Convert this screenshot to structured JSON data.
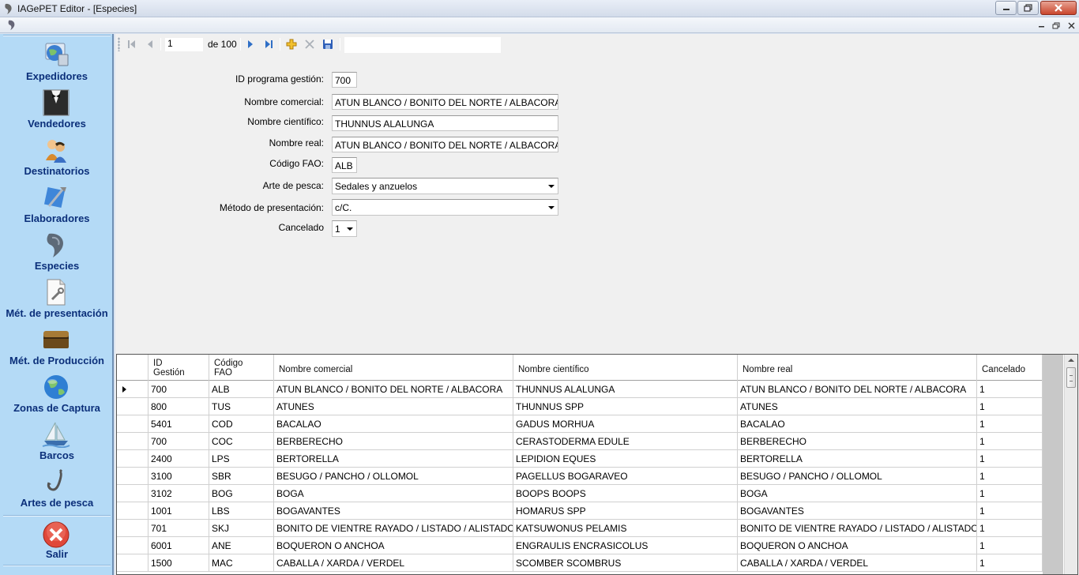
{
  "window": {
    "title": "IAGePET Editor - [Especies]"
  },
  "sidebar": {
    "items": [
      {
        "label": "Expedidores",
        "icon": "globe-pc-icon"
      },
      {
        "label": "Vendedores",
        "icon": "tuxedo-icon"
      },
      {
        "label": "Destinatorios",
        "icon": "users-icon"
      },
      {
        "label": "Elaboradores",
        "icon": "tools-icon"
      },
      {
        "label": "Especies",
        "icon": "fish-icon"
      },
      {
        "label": "Mét. de presentación",
        "icon": "document-wrench-icon"
      },
      {
        "label": "Mét. de Producción",
        "icon": "chest-icon"
      },
      {
        "label": "Zonas de Captura",
        "icon": "globe-icon"
      },
      {
        "label": "Barcos",
        "icon": "boat-icon"
      },
      {
        "label": "Artes de pesca",
        "icon": "hook-icon"
      }
    ],
    "exit": {
      "label": "Salir",
      "icon": "exit-icon"
    }
  },
  "navigator": {
    "position": "1",
    "count": "de 100"
  },
  "form": {
    "id_label": "ID programa gestión:",
    "id_value": "700",
    "nombre_comercial_label": "Nombre comercial:",
    "nombre_comercial_value": "ATUN BLANCO / BONITO DEL NORTE / ALBACORA",
    "nombre_cientifico_label": "Nombre científico:",
    "nombre_cientifico_value": "THUNNUS  ALALUNGA",
    "nombre_real_label": "Nombre real:",
    "nombre_real_value": "ATUN BLANCO / BONITO DEL NORTE / ALBACORA",
    "codigo_fao_label": "Código FAO:",
    "codigo_fao_value": "ALB",
    "arte_label": "Arte de pesca:",
    "arte_value": "Sedales y anzuelos",
    "metodo_label": "Método de presentación:",
    "metodo_value": "c/C.",
    "cancelado_label": "Cancelado",
    "cancelado_value": "1"
  },
  "grid": {
    "columns": [
      "ID\nGestión",
      "Código\nFAO",
      "Nombre comercial",
      "Nombre científico",
      "Nombre real",
      "Cancelado"
    ],
    "rows": [
      [
        "700",
        "ALB",
        "ATUN BLANCO / BONITO DEL NORTE / ALBACORA",
        "THUNNUS  ALALUNGA",
        "ATUN BLANCO / BONITO DEL NORTE / ALBACORA",
        "1"
      ],
      [
        "800",
        "TUS",
        "ATUNES",
        "THUNNUS SPP",
        "ATUNES",
        "1"
      ],
      [
        "5401",
        "COD",
        "BACALAO",
        "GADUS MORHUA",
        "BACALAO",
        "1"
      ],
      [
        "700",
        "COC",
        "BERBERECHO",
        "CERASTODERMA EDULE",
        "BERBERECHO",
        "1"
      ],
      [
        "2400",
        "LPS",
        "BERTORELLA",
        "LEPIDION EQUES",
        "BERTORELLA",
        "1"
      ],
      [
        "3100",
        "SBR",
        "BESUGO / PANCHO / OLLOMOL",
        "PAGELLUS  BOGARAVEO",
        "BESUGO / PANCHO / OLLOMOL",
        "1"
      ],
      [
        "3102",
        "BOG",
        "BOGA",
        "BOOPS BOOPS",
        "BOGA",
        "1"
      ],
      [
        "1001",
        "LBS",
        "BOGAVANTES",
        "HOMARUS SPP",
        "BOGAVANTES",
        "1"
      ],
      [
        "701",
        "SKJ",
        "BONITO DE VIENTRE RAYADO / LISTADO / ALISTADO",
        "KATSUWONUS PELAMIS",
        "BONITO DE VIENTRE RAYADO / LISTADO / ALISTADO",
        "1"
      ],
      [
        "6001",
        "ANE",
        "BOQUERON O ANCHOA",
        "ENGRAULIS ENCRASICOLUS",
        "BOQUERON O ANCHOA",
        "1"
      ],
      [
        "1500",
        "MAC",
        "CABALLA / XARDA /  VERDEL",
        "SCOMBER SCOMBRUS",
        "CABALLA / XARDA /  VERDEL",
        "1"
      ]
    ]
  }
}
